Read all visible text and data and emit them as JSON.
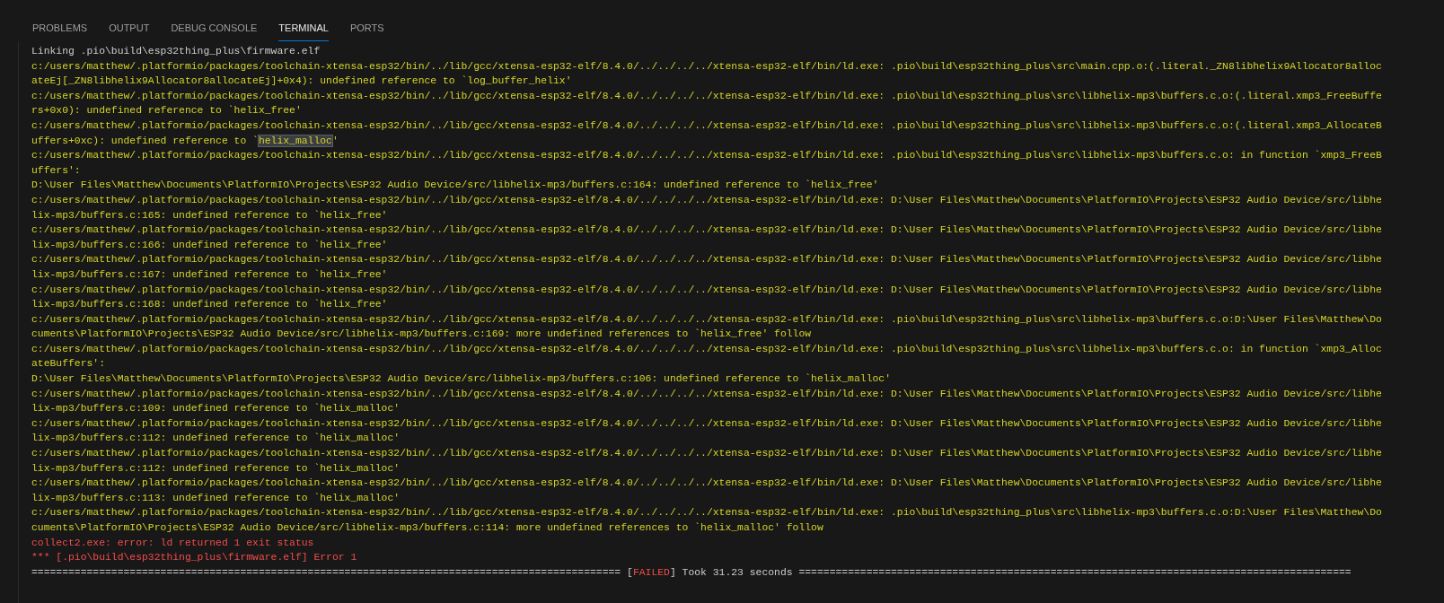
{
  "tabs": [
    {
      "label": "PROBLEMS",
      "selected": false
    },
    {
      "label": "OUTPUT",
      "selected": false
    },
    {
      "label": "DEBUG CONSOLE",
      "selected": false
    },
    {
      "label": "TERMINAL",
      "selected": true
    },
    {
      "label": "PORTS",
      "selected": false
    }
  ],
  "terminal": {
    "lines": [
      {
        "kind": "plain",
        "text": "Linking .pio\\build\\esp32thing_plus\\firmware.elf"
      },
      {
        "kind": "warn",
        "text": "c:/users/matthew/.platformio/packages/toolchain-xtensa-esp32/bin/../lib/gcc/xtensa-esp32-elf/8.4.0/../../../../xtensa-esp32-elf/bin/ld.exe: .pio\\build\\esp32thing_plus\\src\\main.cpp.o:(.literal._ZN8libhelix9Allocator8alloc"
      },
      {
        "kind": "warn",
        "text": "ateEj[_ZN8libhelix9Allocator8allocateEj]+0x4): undefined reference to `log_buffer_helix'"
      },
      {
        "kind": "warn",
        "text": "c:/users/matthew/.platformio/packages/toolchain-xtensa-esp32/bin/../lib/gcc/xtensa-esp32-elf/8.4.0/../../../../xtensa-esp32-elf/bin/ld.exe: .pio\\build\\esp32thing_plus\\src\\libhelix-mp3\\buffers.c.o:(.literal.xmp3_FreeBuffe"
      },
      {
        "kind": "warn",
        "text": "rs+0x0): undefined reference to `helix_free'"
      },
      {
        "kind": "warn",
        "text": "c:/users/matthew/.platformio/packages/toolchain-xtensa-esp32/bin/../lib/gcc/xtensa-esp32-elf/8.4.0/../../../../xtensa-esp32-elf/bin/ld.exe: .pio\\build\\esp32thing_plus\\src\\libhelix-mp3\\buffers.c.o:(.literal.xmp3_AllocateB"
      },
      {
        "kind": "warn",
        "parts": [
          {
            "text": "uffers+0xc): undefined reference to `",
            "selected": false
          },
          {
            "text": "helix_malloc",
            "selected": true
          },
          {
            "text": "'",
            "selected": false
          }
        ]
      },
      {
        "kind": "warn",
        "text": "c:/users/matthew/.platformio/packages/toolchain-xtensa-esp32/bin/../lib/gcc/xtensa-esp32-elf/8.4.0/../../../../xtensa-esp32-elf/bin/ld.exe: .pio\\build\\esp32thing_plus\\src\\libhelix-mp3\\buffers.c.o: in function `xmp3_FreeB"
      },
      {
        "kind": "warn",
        "text": "uffers':"
      },
      {
        "kind": "warn",
        "text": "D:\\User Files\\Matthew\\Documents\\PlatformIO\\Projects\\ESP32 Audio Device/src/libhelix-mp3/buffers.c:164: undefined reference to `helix_free'"
      },
      {
        "kind": "warn",
        "text": "c:/users/matthew/.platformio/packages/toolchain-xtensa-esp32/bin/../lib/gcc/xtensa-esp32-elf/8.4.0/../../../../xtensa-esp32-elf/bin/ld.exe: D:\\User Files\\Matthew\\Documents\\PlatformIO\\Projects\\ESP32 Audio Device/src/libhe"
      },
      {
        "kind": "warn",
        "text": "lix-mp3/buffers.c:165: undefined reference to `helix_free'"
      },
      {
        "kind": "warn",
        "text": "c:/users/matthew/.platformio/packages/toolchain-xtensa-esp32/bin/../lib/gcc/xtensa-esp32-elf/8.4.0/../../../../xtensa-esp32-elf/bin/ld.exe: D:\\User Files\\Matthew\\Documents\\PlatformIO\\Projects\\ESP32 Audio Device/src/libhe"
      },
      {
        "kind": "warn",
        "text": "lix-mp3/buffers.c:166: undefined reference to `helix_free'"
      },
      {
        "kind": "warn",
        "text": "c:/users/matthew/.platformio/packages/toolchain-xtensa-esp32/bin/../lib/gcc/xtensa-esp32-elf/8.4.0/../../../../xtensa-esp32-elf/bin/ld.exe: D:\\User Files\\Matthew\\Documents\\PlatformIO\\Projects\\ESP32 Audio Device/src/libhe"
      },
      {
        "kind": "warn",
        "text": "lix-mp3/buffers.c:167: undefined reference to `helix_free'"
      },
      {
        "kind": "warn",
        "text": "c:/users/matthew/.platformio/packages/toolchain-xtensa-esp32/bin/../lib/gcc/xtensa-esp32-elf/8.4.0/../../../../xtensa-esp32-elf/bin/ld.exe: D:\\User Files\\Matthew\\Documents\\PlatformIO\\Projects\\ESP32 Audio Device/src/libhe"
      },
      {
        "kind": "warn",
        "text": "lix-mp3/buffers.c:168: undefined reference to `helix_free'"
      },
      {
        "kind": "warn",
        "text": "c:/users/matthew/.platformio/packages/toolchain-xtensa-esp32/bin/../lib/gcc/xtensa-esp32-elf/8.4.0/../../../../xtensa-esp32-elf/bin/ld.exe: .pio\\build\\esp32thing_plus\\src\\libhelix-mp3\\buffers.c.o:D:\\User Files\\Matthew\\Do"
      },
      {
        "kind": "warn",
        "text": "cuments\\PlatformIO\\Projects\\ESP32 Audio Device/src/libhelix-mp3/buffers.c:169: more undefined references to `helix_free' follow"
      },
      {
        "kind": "warn",
        "text": "c:/users/matthew/.platformio/packages/toolchain-xtensa-esp32/bin/../lib/gcc/xtensa-esp32-elf/8.4.0/../../../../xtensa-esp32-elf/bin/ld.exe: .pio\\build\\esp32thing_plus\\src\\libhelix-mp3\\buffers.c.o: in function `xmp3_Alloc"
      },
      {
        "kind": "warn",
        "text": "ateBuffers':"
      },
      {
        "kind": "warn",
        "text": "D:\\User Files\\Matthew\\Documents\\PlatformIO\\Projects\\ESP32 Audio Device/src/libhelix-mp3/buffers.c:106: undefined reference to `helix_malloc'"
      },
      {
        "kind": "warn",
        "text": "c:/users/matthew/.platformio/packages/toolchain-xtensa-esp32/bin/../lib/gcc/xtensa-esp32-elf/8.4.0/../../../../xtensa-esp32-elf/bin/ld.exe: D:\\User Files\\Matthew\\Documents\\PlatformIO\\Projects\\ESP32 Audio Device/src/libhe"
      },
      {
        "kind": "warn",
        "text": "lix-mp3/buffers.c:109: undefined reference to `helix_malloc'"
      },
      {
        "kind": "warn",
        "text": "c:/users/matthew/.platformio/packages/toolchain-xtensa-esp32/bin/../lib/gcc/xtensa-esp32-elf/8.4.0/../../../../xtensa-esp32-elf/bin/ld.exe: D:\\User Files\\Matthew\\Documents\\PlatformIO\\Projects\\ESP32 Audio Device/src/libhe"
      },
      {
        "kind": "warn",
        "text": "lix-mp3/buffers.c:112: undefined reference to `helix_malloc'"
      },
      {
        "kind": "warn",
        "text": "c:/users/matthew/.platformio/packages/toolchain-xtensa-esp32/bin/../lib/gcc/xtensa-esp32-elf/8.4.0/../../../../xtensa-esp32-elf/bin/ld.exe: D:\\User Files\\Matthew\\Documents\\PlatformIO\\Projects\\ESP32 Audio Device/src/libhe"
      },
      {
        "kind": "warn",
        "text": "lix-mp3/buffers.c:112: undefined reference to `helix_malloc'"
      },
      {
        "kind": "warn",
        "text": "c:/users/matthew/.platformio/packages/toolchain-xtensa-esp32/bin/../lib/gcc/xtensa-esp32-elf/8.4.0/../../../../xtensa-esp32-elf/bin/ld.exe: D:\\User Files\\Matthew\\Documents\\PlatformIO\\Projects\\ESP32 Audio Device/src/libhe"
      },
      {
        "kind": "warn",
        "text": "lix-mp3/buffers.c:113: undefined reference to `helix_malloc'"
      },
      {
        "kind": "warn",
        "text": "c:/users/matthew/.platformio/packages/toolchain-xtensa-esp32/bin/../lib/gcc/xtensa-esp32-elf/8.4.0/../../../../xtensa-esp32-elf/bin/ld.exe: .pio\\build\\esp32thing_plus\\src\\libhelix-mp3\\buffers.c.o:D:\\User Files\\Matthew\\Do"
      },
      {
        "kind": "warn",
        "text": "cuments\\PlatformIO\\Projects\\ESP32 Audio Device/src/libhelix-mp3/buffers.c:114: more undefined references to `helix_malloc' follow"
      },
      {
        "kind": "error",
        "text": "collect2.exe: error: ld returned 1 exit status"
      },
      {
        "kind": "error",
        "text": "*** [.pio\\build\\esp32thing_plus\\firmware.elf] Error 1"
      },
      {
        "kind": "summary",
        "parts": [
          {
            "text": "================================================================================================ [",
            "kind": "plain"
          },
          {
            "text": "FAILED",
            "kind": "error"
          },
          {
            "text": "] Took 31.23 seconds ==========================================================================================",
            "kind": "plain"
          }
        ]
      }
    ]
  }
}
